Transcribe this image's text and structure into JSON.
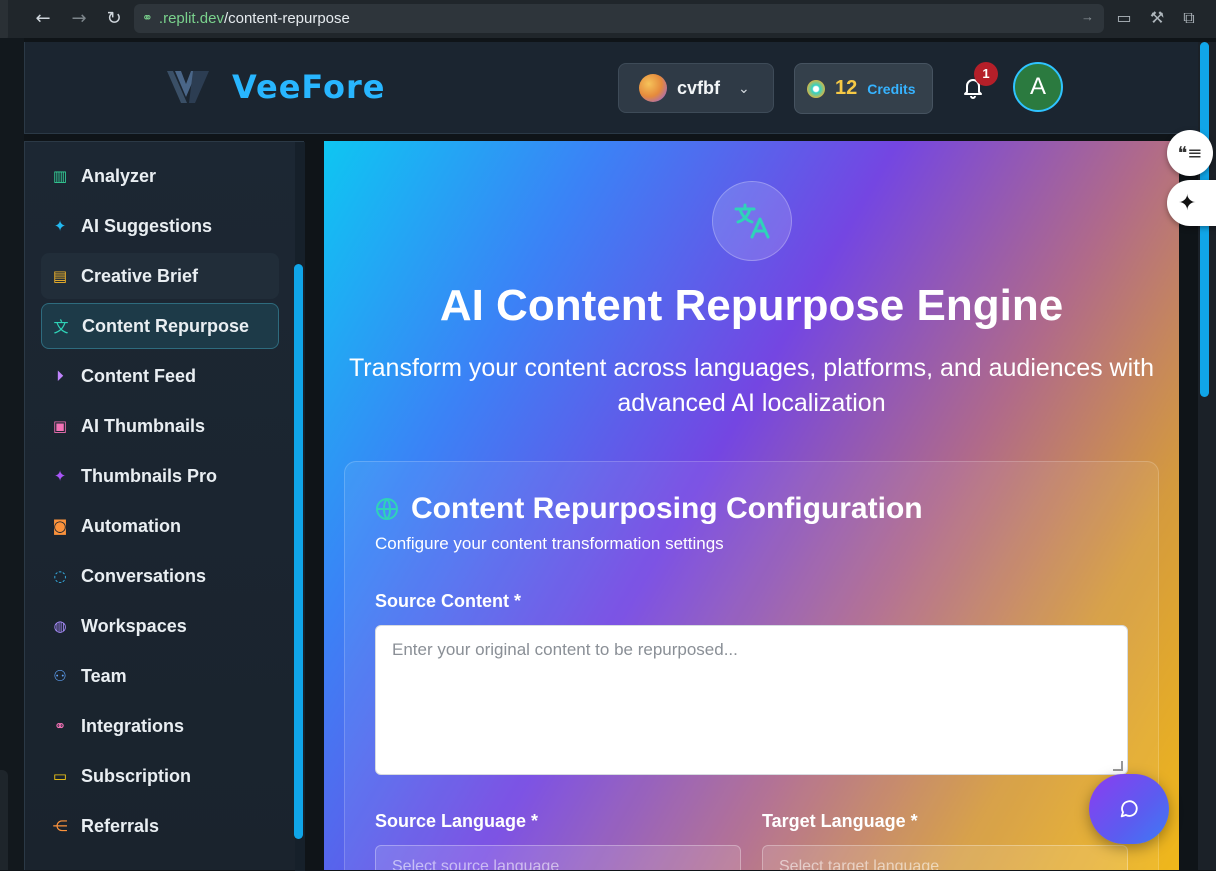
{
  "browser": {
    "url_domain": ".replit.dev",
    "url_path": "/content-repurpose"
  },
  "header": {
    "brand": "VeeFore",
    "workspace_name": "cvfbf",
    "credits_value": "12",
    "credits_label": "Credits",
    "notification_count": "1",
    "user_initial": "A"
  },
  "sidebar": {
    "items": [
      {
        "label": "Analyzer",
        "icon": "bar-chart-icon",
        "color": "#34d399"
      },
      {
        "label": "AI Suggestions",
        "icon": "sparkles-icon",
        "color": "#22b8f0"
      },
      {
        "label": "Creative Brief",
        "icon": "document-icon",
        "color": "#f5b62a"
      },
      {
        "label": "Content Repurpose",
        "icon": "translate-icon",
        "color": "#2fd3b8"
      },
      {
        "label": "Content Feed",
        "icon": "play-circle-icon",
        "color": "#c084fc"
      },
      {
        "label": "AI Thumbnails",
        "icon": "image-icon",
        "color": "#f472b6"
      },
      {
        "label": "Thumbnails Pro",
        "icon": "sparkles-icon",
        "color": "#a855f7"
      },
      {
        "label": "Automation",
        "icon": "bot-icon",
        "color": "#fb923c"
      },
      {
        "label": "Conversations",
        "icon": "chat-icon",
        "color": "#38bdf8"
      },
      {
        "label": "Workspaces",
        "icon": "globe-icon",
        "color": "#a78bfa"
      },
      {
        "label": "Team",
        "icon": "users-icon",
        "color": "#60a5fa"
      },
      {
        "label": "Integrations",
        "icon": "link-icon",
        "color": "#f472b6"
      },
      {
        "label": "Subscription",
        "icon": "card-icon",
        "color": "#facc15"
      },
      {
        "label": "Referrals",
        "icon": "share-icon",
        "color": "#fb923c"
      }
    ]
  },
  "hero": {
    "title": "AI Content Repurpose Engine",
    "subtitle": "Transform your content across languages, platforms, and audiences with advanced AI localization"
  },
  "config": {
    "title": "Content Repurposing Configuration",
    "subtitle": "Configure your content transformation settings",
    "source_content_label": "Source Content *",
    "source_content_placeholder": "Enter your original content to be repurposed...",
    "source_language_label": "Source Language *",
    "source_language_placeholder": "Select source language",
    "target_language_label": "Target Language *",
    "target_language_placeholder": "Select target language"
  }
}
